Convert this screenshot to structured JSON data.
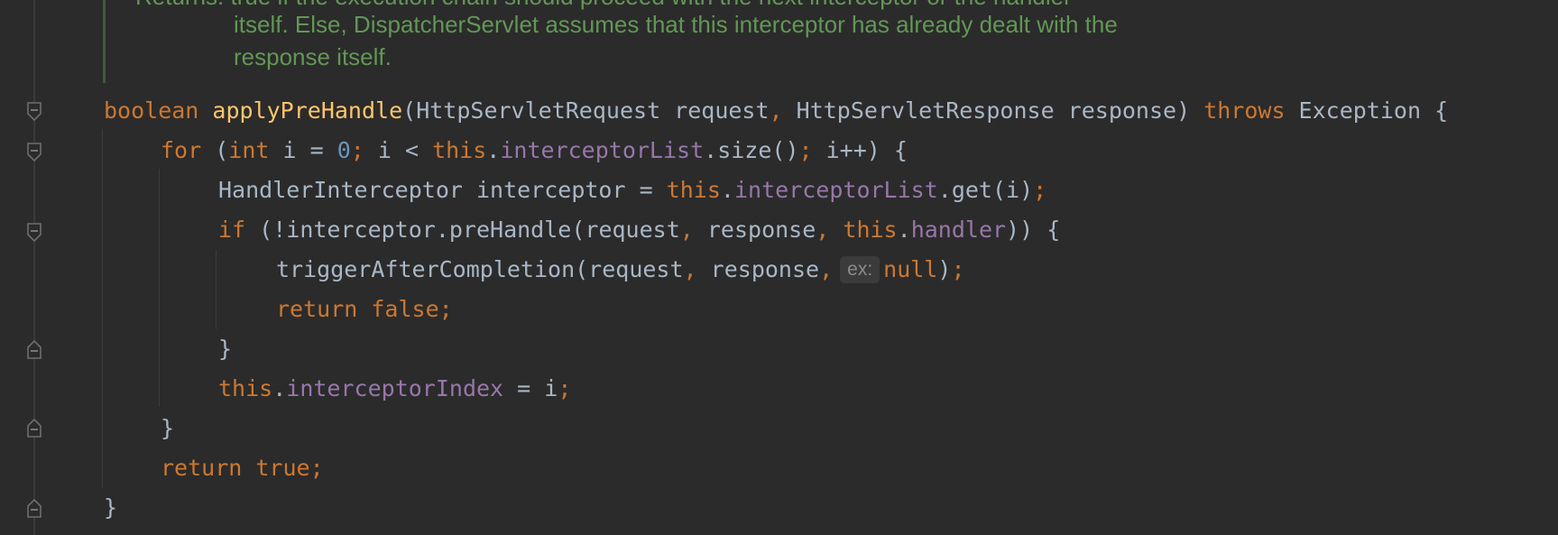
{
  "doc_comment": {
    "line1_clipped": "Returns: true if the execution chain should proceed with the next interceptor or the handler",
    "line2": "itself. Else, DispatcherServlet assumes that this interceptor has already dealt with the",
    "line3": "response itself."
  },
  "code": {
    "l1": {
      "kw_boolean": "boolean",
      "method": "applyPreHandle",
      "p1": "(HttpServletRequest request",
      "c1": ",",
      "p2": " HttpServletResponse response) ",
      "kw_throws": "throws",
      "p3": " Exception {"
    },
    "l2": {
      "kw_for": "for",
      "p1": " (",
      "kw_int": "int",
      "p2": " i = ",
      "num0": "0",
      "s1": ";",
      "p3": " i < ",
      "kw_this": "this",
      "p4": ".",
      "fld": "interceptorList",
      "p5": ".size()",
      "s2": ";",
      "p6": " i++) {"
    },
    "l3": {
      "p1": "HandlerInterceptor interceptor = ",
      "kw_this": "this",
      "p2": ".",
      "fld": "interceptorList",
      "p3": ".get(i)",
      "s1": ";"
    },
    "l4": {
      "kw_if": "if",
      "p1": " (!interceptor.preHandle(request",
      "c1": ",",
      "p2": " response",
      "c2": ",",
      "sp": " ",
      "kw_this": "this",
      "p3": ".",
      "fld": "handler",
      "p4": ")) {"
    },
    "l5": {
      "p1": "triggerAfterCompletion(request",
      "c1": ",",
      "p2": " response",
      "c2": ",",
      "hint": "ex:",
      "kw_null": "null",
      "p3": ")",
      "s1": ";"
    },
    "l6": {
      "kw_return": "return",
      "sp": " ",
      "kw_false": "false",
      "s1": ";"
    },
    "l7": {
      "p1": "}"
    },
    "l8": {
      "kw_this": "this",
      "p1": ".",
      "fld": "interceptorIndex",
      "p2": " = i",
      "s1": ";"
    },
    "l9": {
      "p1": "}"
    },
    "l10": {
      "kw_return": "return",
      "sp": " ",
      "kw_true": "true",
      "s1": ";"
    },
    "l11": {
      "p1": "}"
    }
  },
  "fold_icons": [
    "fold-open-icon",
    "fold-open-icon",
    "fold-open-icon",
    "fold-close-icon",
    "fold-close-icon",
    "fold-close-icon"
  ],
  "colors": {
    "background": "#2b2b2b",
    "keyword": "#cc7832",
    "method": "#ffc66d",
    "field": "#9876aa",
    "number": "#6897bb",
    "text": "#a9b7c6",
    "doc_comment": "#629755"
  }
}
